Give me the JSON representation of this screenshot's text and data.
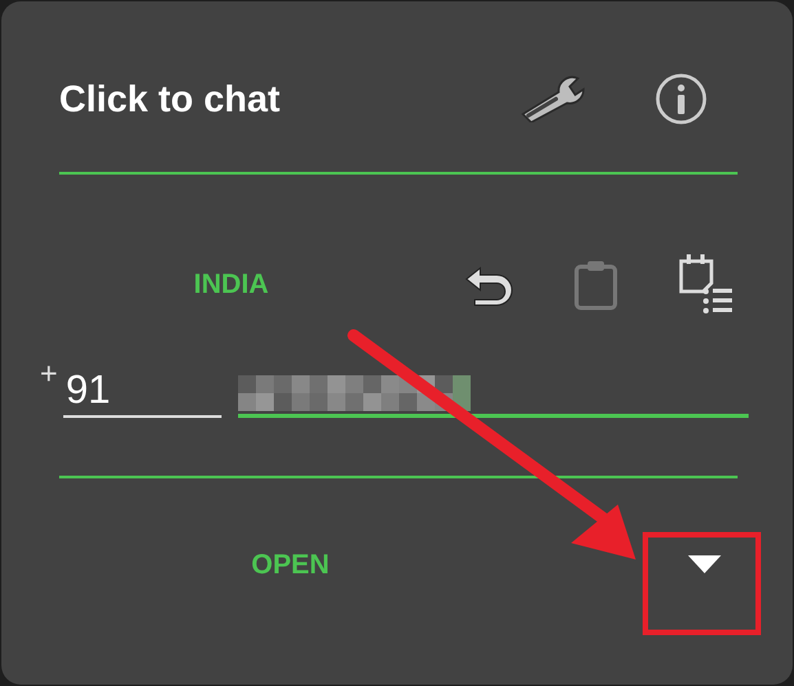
{
  "dialog": {
    "title": "Click to chat"
  },
  "country": {
    "name": "INDIA"
  },
  "phone": {
    "prefix": "+",
    "country_code": "91"
  },
  "action": {
    "label": "OPEN"
  }
}
